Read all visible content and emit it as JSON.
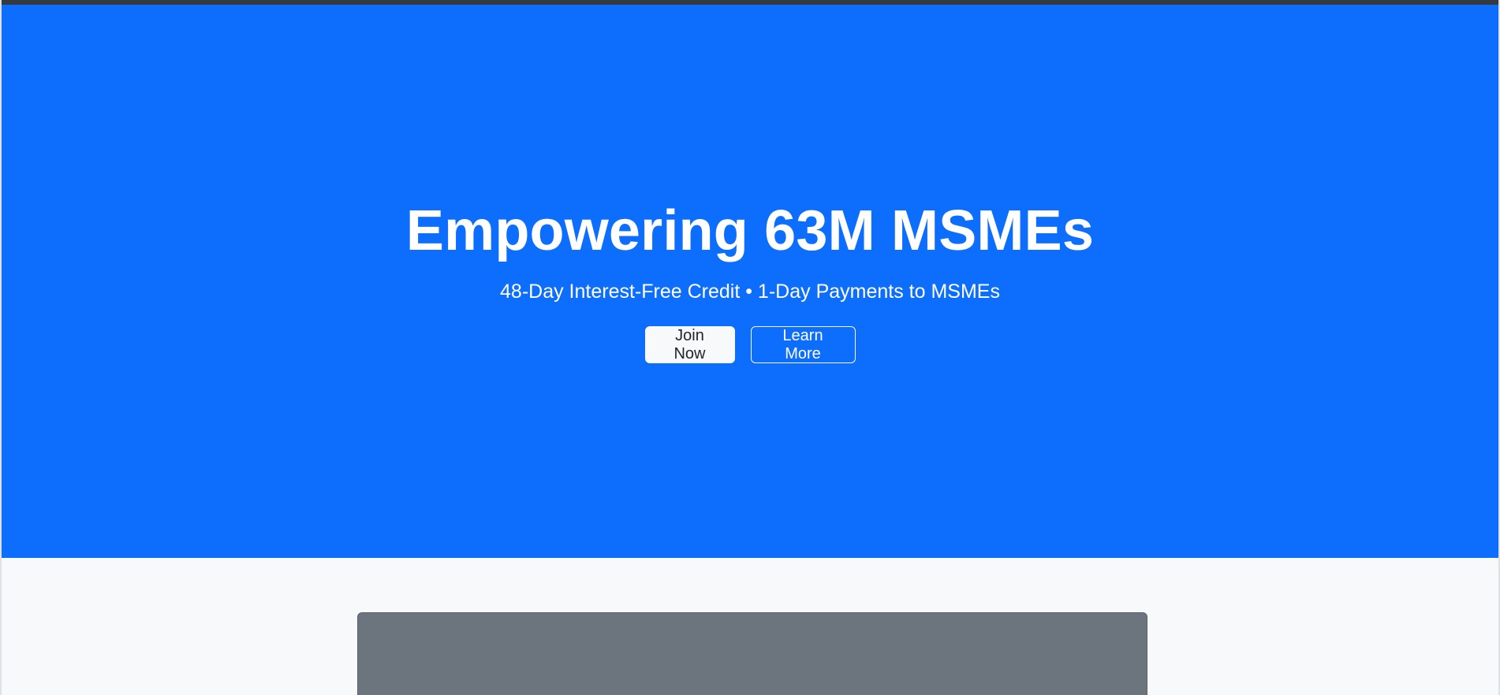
{
  "hero": {
    "title": "Empowering 63M MSMEs",
    "subtitle": "48-Day Interest-Free Credit • 1-Day Payments to MSMEs",
    "primary_button": "Join Now",
    "secondary_button": "Learn More"
  },
  "colors": {
    "hero_background": "#0d6efd",
    "section_background": "#f8f9fa",
    "placeholder_card": "#6c757d",
    "top_bar": "#343a40"
  }
}
